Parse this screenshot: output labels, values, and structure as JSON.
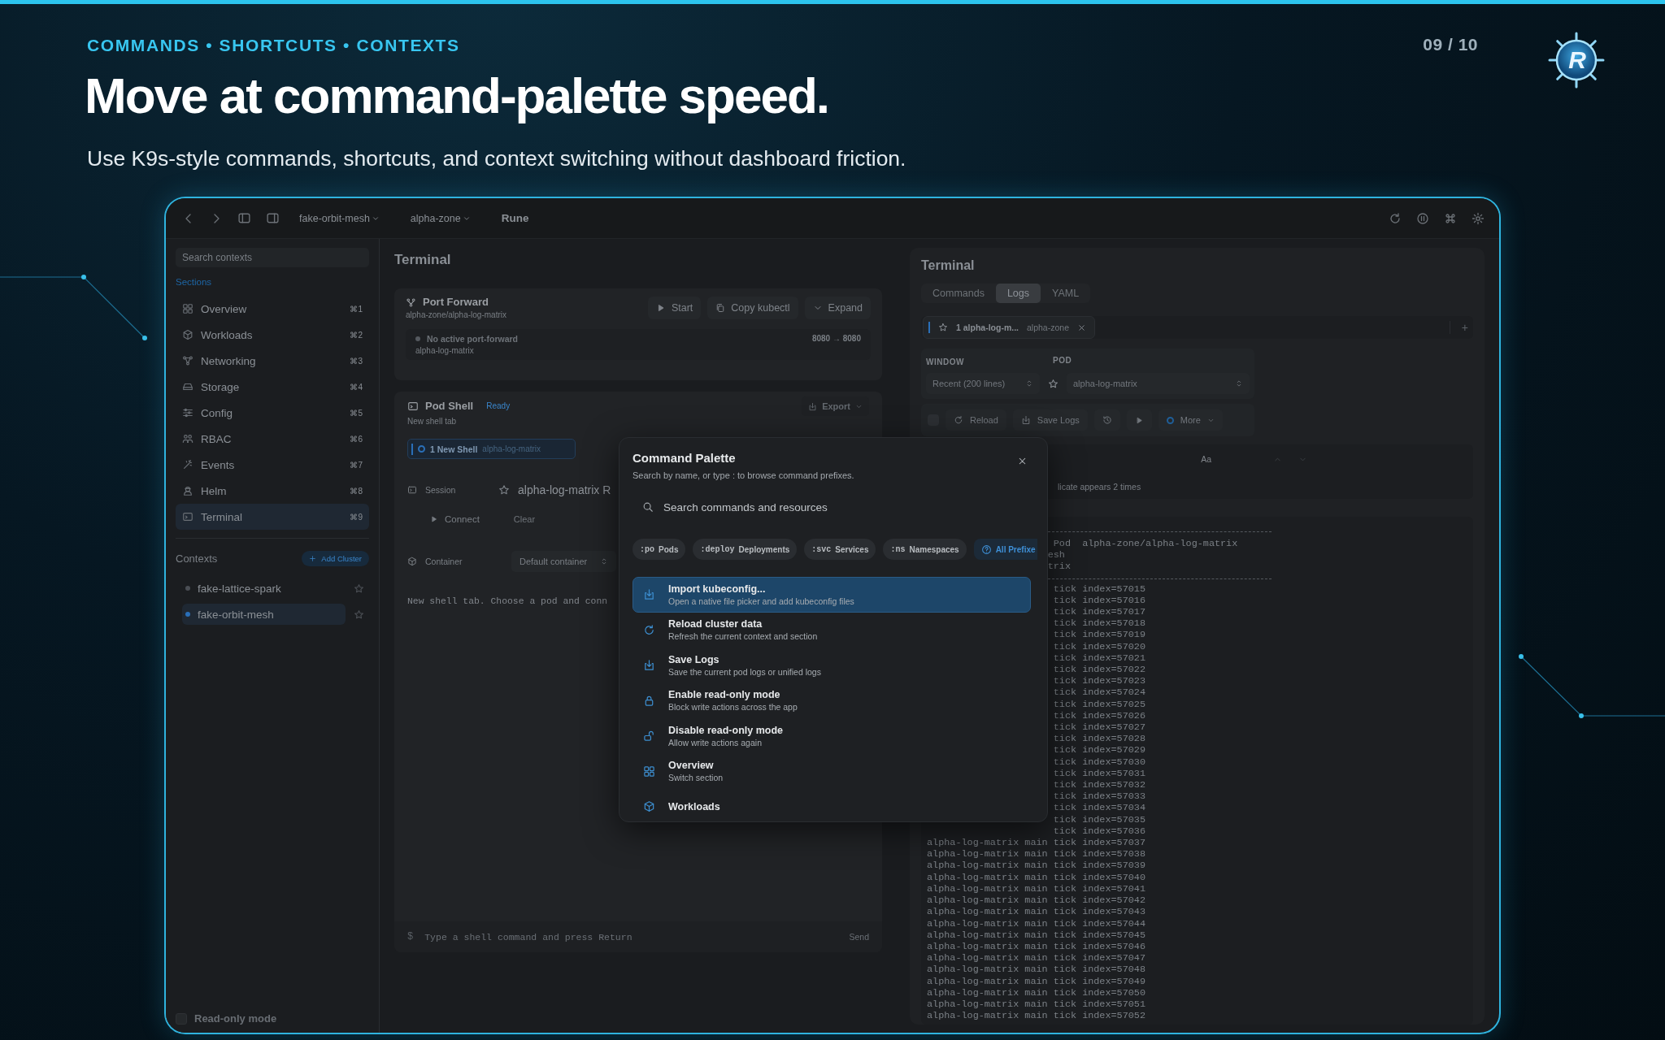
{
  "slide": {
    "kicker": "COMMANDS • SHORTCUTS • CONTEXTS",
    "title": "Move at command-palette speed.",
    "subtitle": "Use K9s-style commands, shortcuts, and context switching without dashboard friction.",
    "page": "09 / 10",
    "logo_letter": "R"
  },
  "toolbar": {
    "context": "fake-orbit-mesh",
    "namespace": "alpha-zone",
    "app_name": "Rune"
  },
  "sidebar": {
    "search": {
      "placeholder": "Search contexts"
    },
    "sections_label": "Sections",
    "items": [
      {
        "label": "Overview",
        "shortcut": "⌘1",
        "selected": false
      },
      {
        "label": "Workloads",
        "shortcut": "⌘2",
        "selected": false
      },
      {
        "label": "Networking",
        "shortcut": "⌘3",
        "selected": false
      },
      {
        "label": "Storage",
        "shortcut": "⌘4",
        "selected": false
      },
      {
        "label": "Config",
        "shortcut": "⌘5",
        "selected": false
      },
      {
        "label": "RBAC",
        "shortcut": "⌘6",
        "selected": false
      },
      {
        "label": "Events",
        "shortcut": "⌘7",
        "selected": false
      },
      {
        "label": "Helm",
        "shortcut": "⌘8",
        "selected": false
      },
      {
        "label": "Terminal",
        "shortcut": "⌘9",
        "selected": true
      }
    ],
    "contexts_label": "Contexts",
    "add_button": "Add Cluster",
    "contexts": [
      {
        "name": "fake-lattice-spark",
        "color": "#4a4e54",
        "selected": false
      },
      {
        "name": "fake-orbit-mesh",
        "color": "#2a6fb8",
        "selected": true
      }
    ],
    "read_only": {
      "label": "Read-only mode",
      "checked": false
    }
  },
  "shell": {
    "title": "Terminal",
    "port_forward": {
      "title": "Port Forward",
      "target": "alpha-zone/alpha-log-matrix",
      "buttons": [
        "Start",
        "Copy kubectl",
        "Expand"
      ],
      "status": "No active port-forward",
      "pod": "alpha-log-matrix",
      "ports": "8080 → 8080"
    },
    "pod_shell": {
      "title": "Pod Shell",
      "badge": "Ready",
      "subtitle": "New shell tab",
      "export": "Export",
      "tab_label": "1 New Shell",
      "tab_pod": "alpha-log-matrix",
      "session_label": "Session",
      "session_pod": "alpha-log-matrix R",
      "connect": "Connect",
      "clear": "Clear",
      "container_label": "Container",
      "container": "Default container",
      "message": "New shell tab. Choose a pod and conn",
      "prompt": "$",
      "input_placeholder": "Type a shell command and press Return",
      "send": "Send"
    }
  },
  "logs": {
    "title": "Terminal",
    "tabs": [
      {
        "label": "Commands",
        "selected": false
      },
      {
        "label": "Logs",
        "selected": true
      },
      {
        "label": "YAML",
        "selected": false
      }
    ],
    "log_tab": {
      "label": "1 alpha-log-m...",
      "namespace": "alpha-zone"
    },
    "add": "+",
    "window_label": "WINDOW",
    "window": "Recent (200 lines)",
    "pod_label": "POD",
    "pod": "alpha-log-matrix",
    "actions": [
      "Reload",
      "Save Logs",
      "More"
    ],
    "find": "Aa",
    "notice": "licate appears 2 times",
    "header_lines": [
      "Pod  alpha-zone/alpha-log-matrix",
      "esh",
      "trix"
    ],
    "lines": [
      {
        "text": "tick index=57015"
      },
      {
        "text": "tick index=57016"
      },
      {
        "text": "tick index=57017"
      },
      {
        "text": "tick index=57018"
      },
      {
        "text": "tick index=57019"
      },
      {
        "text": "tick index=57020"
      },
      {
        "text": "tick index=57021"
      },
      {
        "text": "tick index=57022"
      },
      {
        "text": "tick index=57023"
      },
      {
        "text": "tick index=57024"
      },
      {
        "text": "tick index=57025"
      },
      {
        "text": "tick index=57026"
      },
      {
        "text": "tick index=57027"
      },
      {
        "text": "tick index=57028"
      },
      {
        "text": "tick index=57029"
      },
      {
        "text": "tick index=57030"
      },
      {
        "text": "tick index=57031"
      },
      {
        "text": "tick index=57032"
      },
      {
        "text": "tick index=57033"
      },
      {
        "text": "tick index=57034"
      },
      {
        "text": "tick index=57035"
      },
      {
        "text": "tick index=57036"
      },
      {
        "source": "alpha-log-matrix main",
        "text": "tick index=57037"
      },
      {
        "source": "alpha-log-matrix main",
        "text": "tick index=57038"
      },
      {
        "source": "alpha-log-matrix main",
        "text": "tick index=57039"
      },
      {
        "source": "alpha-log-matrix main",
        "text": "tick index=57040"
      },
      {
        "source": "alpha-log-matrix main",
        "text": "tick index=57041"
      },
      {
        "source": "alpha-log-matrix main",
        "text": "tick index=57042"
      },
      {
        "source": "alpha-log-matrix main",
        "text": "tick index=57043"
      },
      {
        "source": "alpha-log-matrix main",
        "text": "tick index=57044"
      },
      {
        "source": "alpha-log-matrix main",
        "text": "tick index=57045"
      },
      {
        "source": "alpha-log-matrix main",
        "text": "tick index=57046"
      },
      {
        "source": "alpha-log-matrix main",
        "text": "tick index=57047"
      },
      {
        "source": "alpha-log-matrix main",
        "text": "tick index=57048"
      },
      {
        "source": "alpha-log-matrix main",
        "text": "tick index=57049"
      },
      {
        "source": "alpha-log-matrix main",
        "text": "tick index=57050"
      },
      {
        "source": "alpha-log-matrix main",
        "text": "tick index=57051"
      },
      {
        "source": "alpha-log-matrix main",
        "text": "tick index=57052"
      }
    ]
  },
  "palette": {
    "title": "Command Palette",
    "subtitle": "Search by name, or type : to browse command prefixes.",
    "search": {
      "placeholder": "Search commands and resources"
    },
    "prefixes": [
      {
        "kind": "prefix",
        "prefix": ":po",
        "label": "Pods"
      },
      {
        "kind": "prefix",
        "prefix": ":deploy",
        "label": "Deployments"
      },
      {
        "kind": "prefix",
        "prefix": ":svc",
        "label": "Services"
      },
      {
        "kind": "prefix",
        "prefix": ":ns",
        "label": "Namespaces"
      },
      {
        "kind": "help",
        "label": "All Prefixe"
      }
    ],
    "results": [
      {
        "title": "Import kubeconfig...",
        "subtitle": "Open a native file picker and add kubeconfig files",
        "selected": true
      },
      {
        "title": "Reload cluster data",
        "subtitle": "Refresh the current context and section",
        "selected": false
      },
      {
        "title": "Save Logs",
        "subtitle": "Save the current pod logs or unified logs",
        "selected": false
      },
      {
        "title": "Enable read-only mode",
        "subtitle": "Block write actions across the app",
        "selected": false
      },
      {
        "title": "Disable read-only mode",
        "subtitle": "Allow write actions again",
        "selected": false
      },
      {
        "title": "Overview",
        "subtitle": "Switch section",
        "selected": false
      },
      {
        "title": "Workloads",
        "selected": false
      }
    ]
  }
}
